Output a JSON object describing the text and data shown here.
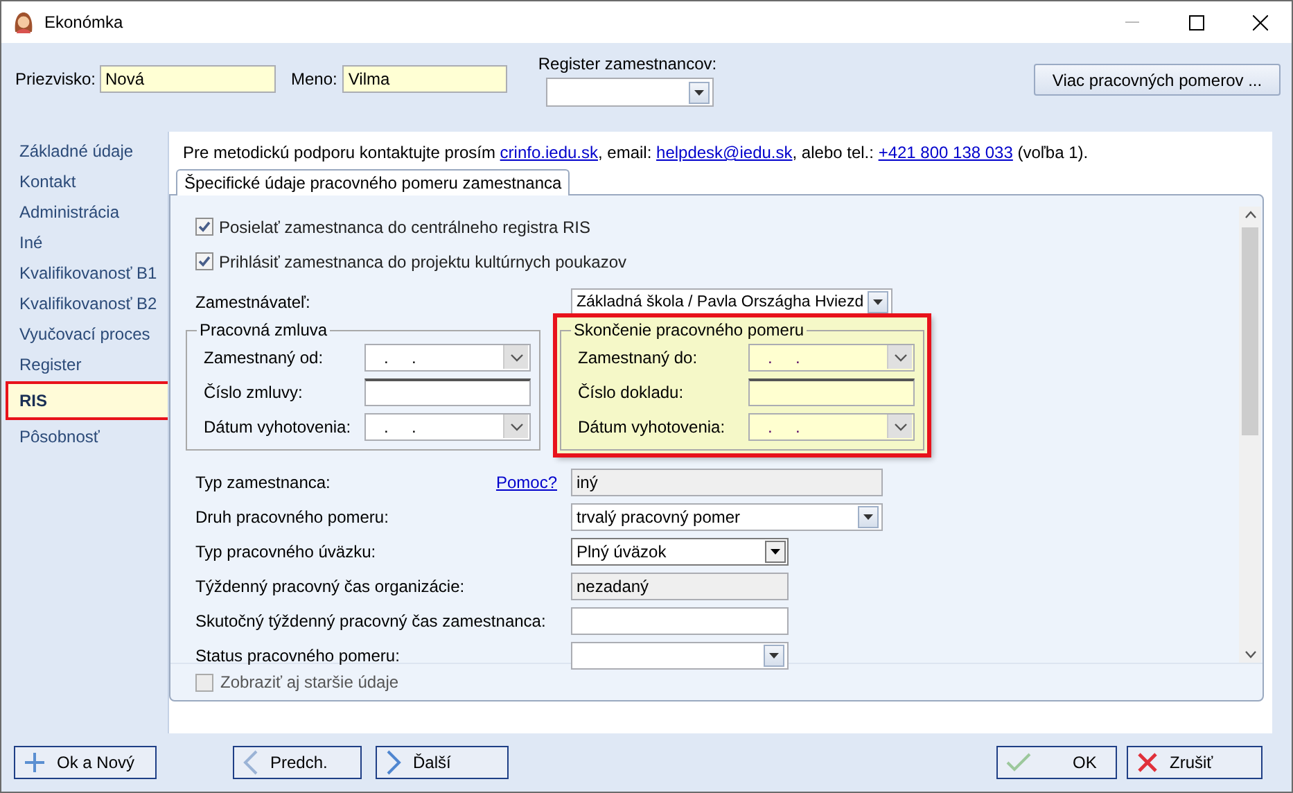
{
  "window": {
    "title": "Ekonómka"
  },
  "header": {
    "surname": {
      "label": "Priezvisko:",
      "value": "Nová"
    },
    "first_name": {
      "label": "Meno:",
      "value": "Vilma"
    },
    "register": {
      "label": "Register zamestnancov:"
    },
    "more_button": "Viac pracovných pomerov ..."
  },
  "sidebar": {
    "items": [
      {
        "label": "Základné údaje",
        "selected": false,
        "highlighted": false
      },
      {
        "label": "Kontakt",
        "selected": false,
        "highlighted": false
      },
      {
        "label": "Administrácia",
        "selected": false,
        "highlighted": false
      },
      {
        "label": "Iné",
        "selected": false,
        "highlighted": false
      },
      {
        "label": "Kvalifikovanosť B1",
        "selected": false,
        "highlighted": false
      },
      {
        "label": "Kvalifikovanosť B2",
        "selected": false,
        "highlighted": false
      },
      {
        "label": "Vyučovací proces",
        "selected": false,
        "highlighted": false
      },
      {
        "label": "Register",
        "selected": false,
        "highlighted": false
      },
      {
        "label": "RIS",
        "selected": true,
        "highlighted": true
      },
      {
        "label": "Pôsobnosť",
        "selected": false,
        "highlighted": false
      }
    ]
  },
  "info": [
    {
      "kind": "text",
      "text": "Pre metodickú podporu kontaktujte prosím "
    },
    {
      "kind": "link",
      "text": "crinfo.iedu.sk"
    },
    {
      "kind": "text",
      "text": ", email: "
    },
    {
      "kind": "link",
      "text": "helpdesk@iedu.sk"
    },
    {
      "kind": "text",
      "text": ", alebo tel.: "
    },
    {
      "kind": "link",
      "text": "+421 800 138 033"
    },
    {
      "kind": "text",
      "text": " (voľba 1)."
    }
  ],
  "group": {
    "title": "Špecifické údaje pracovného pomeru zamestnanca",
    "checkboxes": [
      {
        "label": "Posielať zamestnanca do centrálneho registra RIS",
        "checked": true
      },
      {
        "label": "Prihlásiť zamestnanca do projektu kultúrnych poukazov",
        "checked": true
      }
    ],
    "employer": {
      "label": "Zamestnávateľ:",
      "value": "Základná škola / Pavla Országha Hviezd"
    },
    "subgroups": [
      {
        "title": "Pracovná zmluva",
        "highlighted": false,
        "fields": [
          {
            "kind": "date",
            "label": "Zamestnaný od:",
            "value": ".     ."
          },
          {
            "kind": "text",
            "label": "Číslo zmluvy:"
          },
          {
            "kind": "date",
            "label": "Dátum vyhotovenia:",
            "value": ".     ."
          }
        ]
      },
      {
        "title": "Skončenie pracovného pomeru",
        "highlighted": true,
        "fields": [
          {
            "kind": "date",
            "label": "Zamestnaný do:",
            "value": ".     ."
          },
          {
            "kind": "text",
            "label": "Číslo dokladu:"
          },
          {
            "kind": "date",
            "label": "Dátum vyhotovenia:",
            "value": ".     ."
          }
        ]
      }
    ],
    "rows": [
      {
        "kind": "readonly",
        "label": "Typ zamestnanca:",
        "link": "Pomoc?",
        "value": "iný"
      },
      {
        "kind": "combo",
        "label": "Druh pracovného pomeru:",
        "value": "trvalý pracovný pomer"
      },
      {
        "kind": "dropdown",
        "label": "Typ pracovného úväzku:",
        "value": "Plný úväzok"
      },
      {
        "kind": "readonly",
        "label": "Týždenný pracovný čas organizácie:",
        "value": "nezadaný"
      },
      {
        "kind": "text",
        "label": "Skutočný týždenný pracovný čas zamestnanca:"
      },
      {
        "kind": "combo",
        "label": "Status pracovného pomeru:"
      }
    ],
    "show_older": {
      "label": "Zobraziť aj staršie údaje",
      "checked": false
    }
  },
  "footer": {
    "buttons": [
      {
        "kind": "add",
        "label": "Ok a Nový"
      },
      {
        "kind": "prev",
        "label": "Predch."
      },
      {
        "kind": "next",
        "label": "Ďalší"
      },
      {
        "kind": "ok",
        "label": "OK"
      },
      {
        "kind": "cancel",
        "label": "Zrušiť"
      }
    ]
  }
}
